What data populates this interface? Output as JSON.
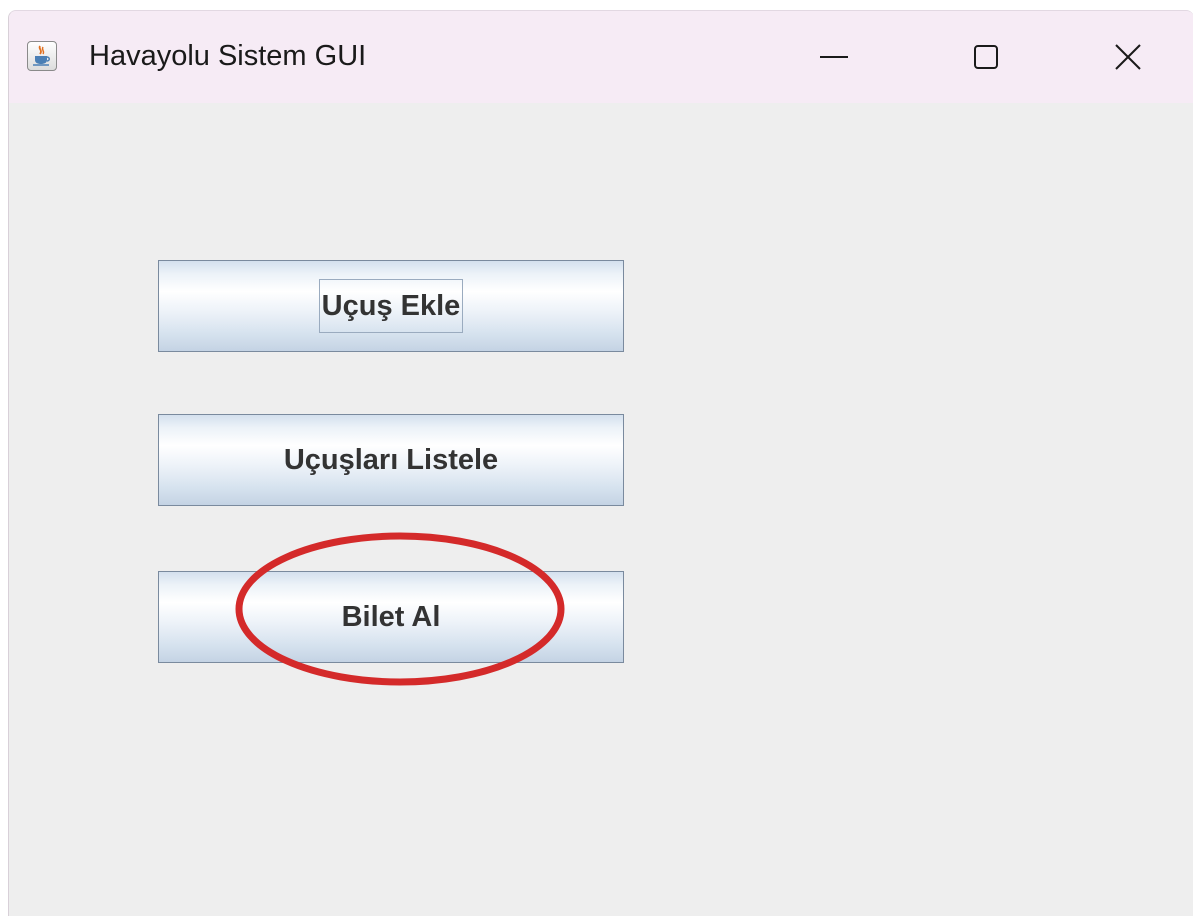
{
  "window": {
    "title": "Havayolu Sistem GUI",
    "icon": "java-coffee-cup-icon",
    "controls": [
      "minimize-icon",
      "maximize-icon",
      "close-icon"
    ]
  },
  "buttons": [
    {
      "label": "Uçuş Ekle",
      "focused": true
    },
    {
      "label": "Uçuşları Listele",
      "focused": false
    },
    {
      "label": "Bilet Al",
      "focused": false,
      "highlighted": true
    }
  ],
  "colors": {
    "titlebar": "#f6ebf5",
    "content_background": "#eeeeee",
    "highlight_annotation": "#d42a2a"
  }
}
